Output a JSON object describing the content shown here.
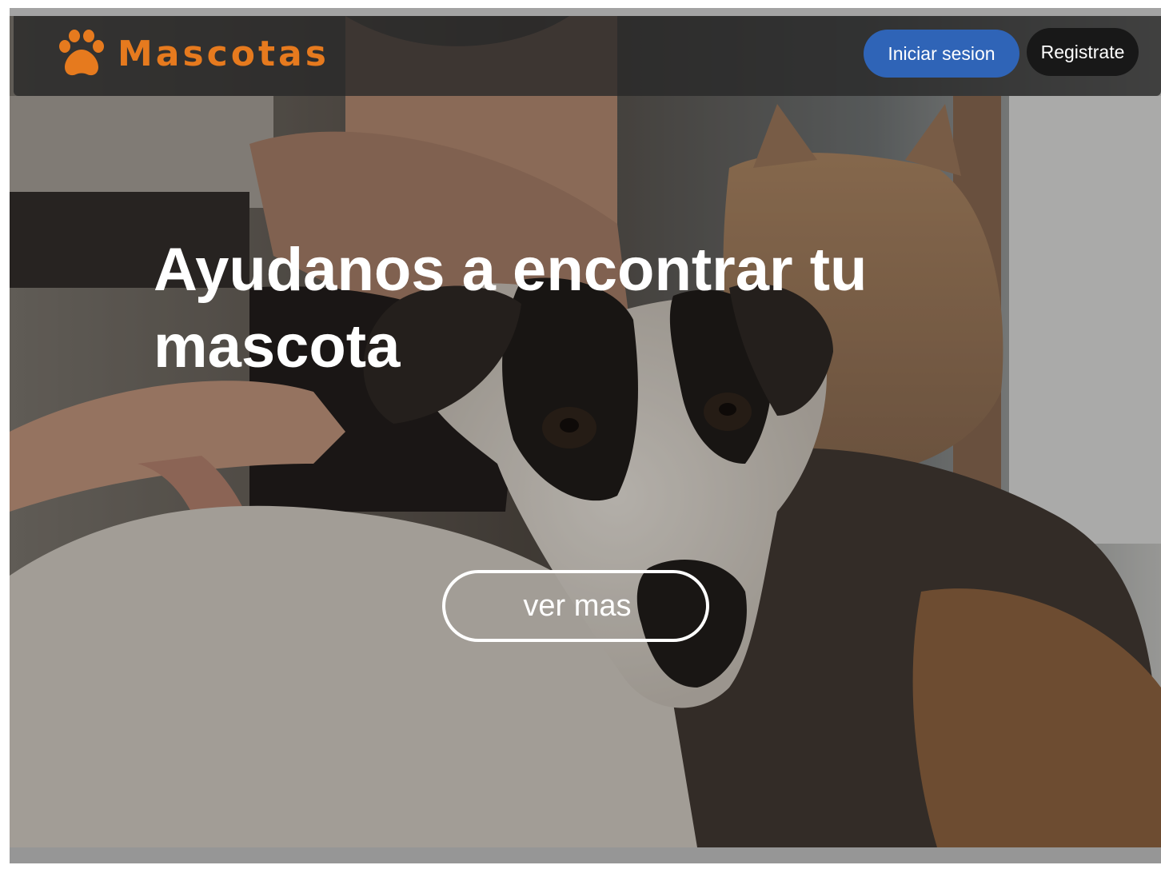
{
  "brand": {
    "name": "Mascotas",
    "icon": "paw-icon",
    "color": "#e67a1e"
  },
  "nav": {
    "login_label": "Iniciar sesion",
    "register_label": "Registrate",
    "login_color": "#2f64b7",
    "register_color": "#181818"
  },
  "hero": {
    "title": "Ayudanos a encontrar tu mascota",
    "cta_label": "ver mas",
    "background": "photo-woman-dog-cats"
  }
}
